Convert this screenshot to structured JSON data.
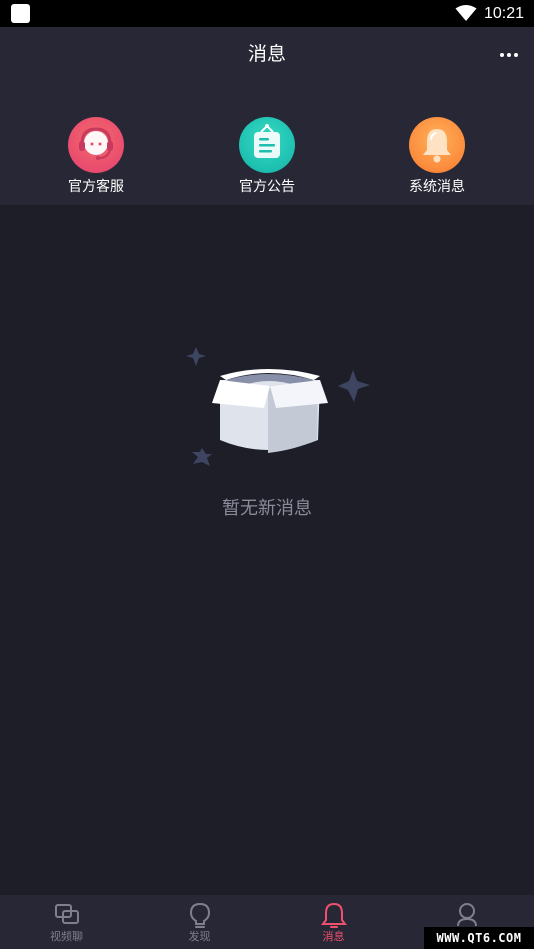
{
  "status_bar": {
    "time": "10:21"
  },
  "header": {
    "title": "消息"
  },
  "categories": [
    {
      "label": "官方客服",
      "icon": "headset-icon",
      "color": "#e94c6f"
    },
    {
      "label": "官方公告",
      "icon": "notice-board-icon",
      "color": "#1dbfb0"
    },
    {
      "label": "系统消息",
      "icon": "bell-icon",
      "color": "#fb8a3c"
    }
  ],
  "empty_state": {
    "text": "暂无新消息",
    "icon": "empty-box-icon"
  },
  "bottom_nav": {
    "items": [
      {
        "label": "视频聊",
        "icon": "video-chat-icon",
        "active": false
      },
      {
        "label": "发现",
        "icon": "lightbulb-icon",
        "active": false
      },
      {
        "label": "消息",
        "icon": "bell-icon",
        "active": true
      },
      {
        "label": "我的",
        "icon": "user-icon",
        "active": false
      }
    ],
    "active_color": "#f0506e"
  },
  "watermark": "WWW.QT6.COM"
}
